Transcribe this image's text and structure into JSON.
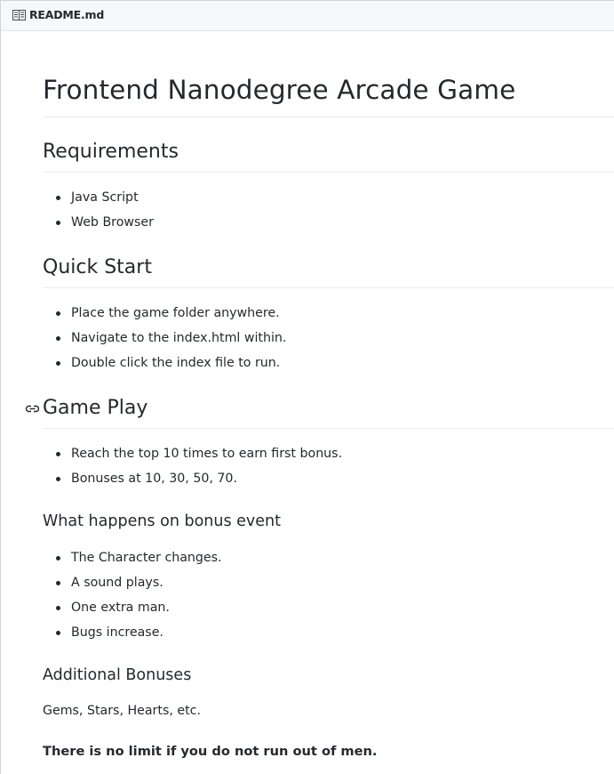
{
  "file": {
    "icon": "book-icon",
    "name": "README.md"
  },
  "readme": {
    "title": "Frontend Nanodegree Arcade Game",
    "requirements": {
      "heading": "Requirements",
      "items": [
        "Java Script",
        "Web Browser"
      ]
    },
    "quick_start": {
      "heading": "Quick Start",
      "items": [
        "Place the game folder anywhere.",
        "Navigate to the index.html within.",
        "Double click the index file to run."
      ]
    },
    "game_play": {
      "heading": "Game Play",
      "anchor_icon": "link-icon",
      "items": [
        "Reach the top 10 times to earn first bonus.",
        "Bonuses at 10, 30, 50, 70."
      ]
    },
    "bonus_event": {
      "heading": "What happens on bonus event",
      "items": [
        "The Character changes.",
        "A sound plays.",
        "One extra man.",
        "Bugs increase."
      ]
    },
    "additional_bonuses": {
      "heading": "Additional Bonuses",
      "text": "Gems, Stars, Hearts, etc."
    },
    "closing_note": "There is no limit if you do not run out of men."
  },
  "colors": {
    "text": "#24292e",
    "header_bg": "#f6f8fa",
    "rule": "#eaecef",
    "border": "#d1d5da"
  }
}
